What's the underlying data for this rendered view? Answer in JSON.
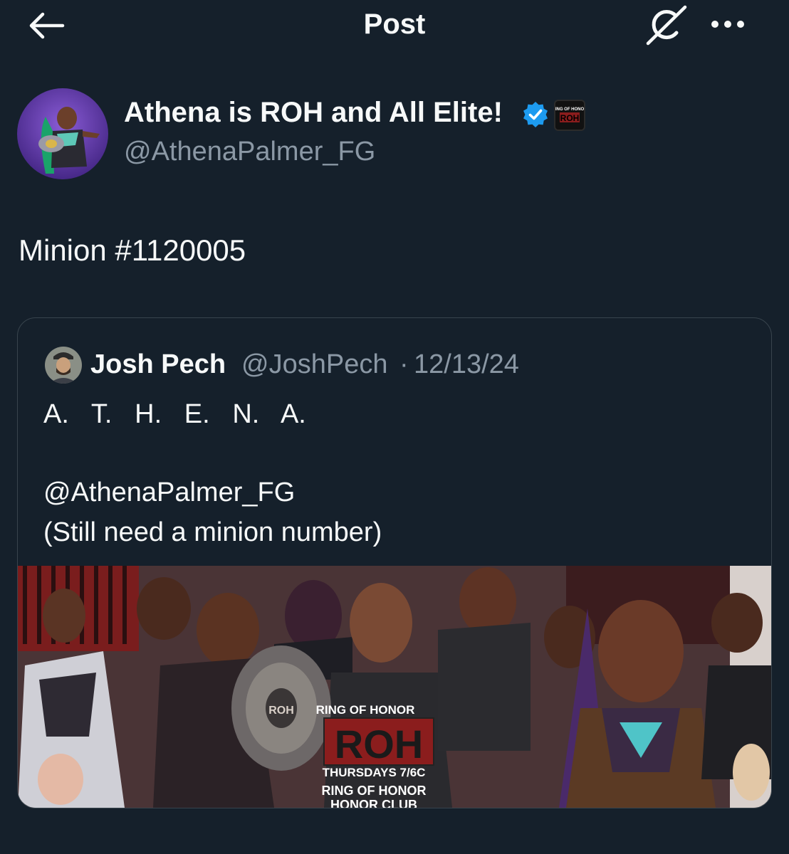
{
  "header": {
    "title": "Post"
  },
  "post": {
    "author": {
      "display_name": "Athena is ROH and All Elite!",
      "handle": "@AthenaPalmer_FG",
      "affiliate_badge_text": "RING OF HONOR ROH"
    },
    "text": "Minion #1120005"
  },
  "quote": {
    "author_name": "Josh Pech",
    "handle": "@JoshPech",
    "separator": "·",
    "date": "12/13/24",
    "lines": [
      "A.   T.   H.   E.   N.   A.",
      "",
      "@AthenaPalmer_FG",
      "(Still need a minion number)"
    ],
    "media": {
      "logo_top": "RING OF HONOR",
      "logo_main": "ROH",
      "schedule": "THURSDAYS 7/6C",
      "logo_bottom": "RING OF HONOR",
      "logo_club": "HONOR CLUB",
      "belt_text": "ROH"
    }
  },
  "icons": [
    "back-arrow-icon",
    "grok-icon",
    "more-icon",
    "verified-badge-icon"
  ],
  "colors": {
    "background": "#15202b",
    "text": "#f7f9f9",
    "secondary": "#8b98a5",
    "verified": "#1d9bf0",
    "border": "#38444d"
  }
}
